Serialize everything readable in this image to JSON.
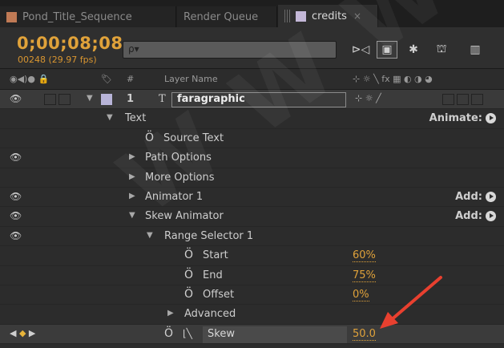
{
  "tabs": [
    {
      "label": "Pond_Title_Sequence",
      "color": "#c07a55"
    },
    {
      "label": "Render Queue"
    },
    {
      "label": "credits",
      "color": "#c4b8d8",
      "close": "×"
    }
  ],
  "toolbar": {
    "timecode": "0;00;08;08",
    "frames": "00248 (29.97 fps)",
    "search_placeholder": "ρ▾"
  },
  "columns": {
    "icons": "◉◀)● 🔒",
    "tag": "🏷",
    "num": "#",
    "layer_name": "Layer Name",
    "switches": "⊹ ☼ ╲ fx ▦ ◐ ◑ ◕"
  },
  "layer": {
    "number": "1",
    "type_glyph": "T",
    "name": "faragraphic"
  },
  "rows": {
    "text": "Text",
    "animate_label": "Animate:",
    "source_text": "Source Text",
    "path_options": "Path Options",
    "more_options": "More Options",
    "animator1": "Animator 1",
    "add_label": "Add:",
    "skew_animator": "Skew Animator",
    "range_selector": "Range Selector 1",
    "start": "Start",
    "start_val": "60%",
    "end": "End",
    "end_val": "75%",
    "offset": "Offset",
    "offset_val": "0%",
    "advanced": "Advanced",
    "skew": "Skew",
    "skew_val": "50.0"
  },
  "colors": {
    "accent": "#e0a23a",
    "arrow": "#e8402f",
    "label_swatch": "#b8b4d8"
  }
}
